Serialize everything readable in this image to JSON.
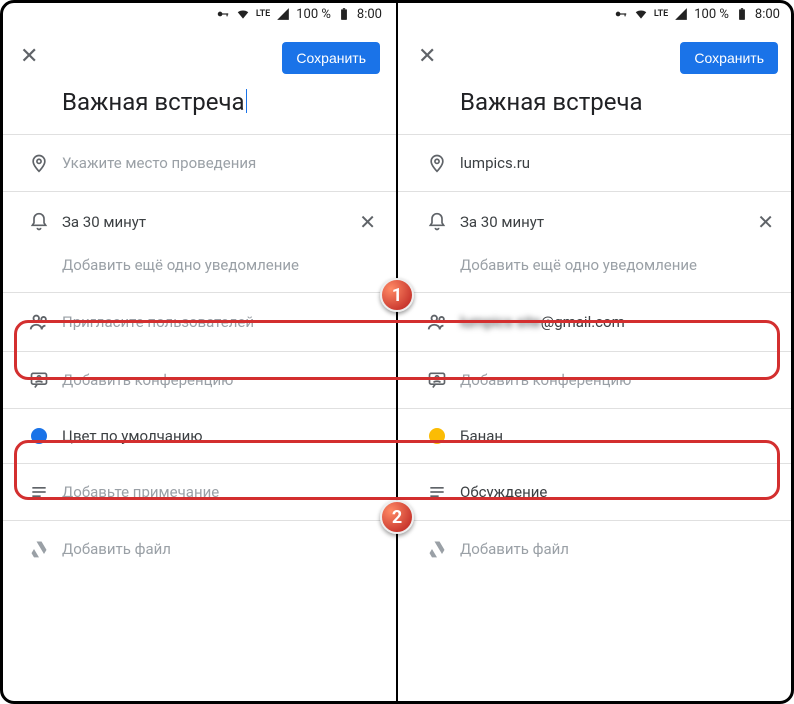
{
  "status": {
    "signal_label": "LTE",
    "battery_pct": "100 %",
    "time": "8:00"
  },
  "header": {
    "save_label": "Сохранить"
  },
  "left": {
    "title": "Важная встреча",
    "location_placeholder": "Укажите место проведения",
    "reminder_text": "За 30 минут",
    "add_reminder_label": "Добавить ещё одно уведомление",
    "invite_placeholder": "Пригласите пользователей",
    "add_conference_label": "Добавить конференцию",
    "color_label": "Цвет по умолчанию",
    "color_hex": "#1a73e8",
    "note_placeholder": "Добавьте примечание",
    "attach_label": "Добавить файл"
  },
  "right": {
    "title": "Важная встреча",
    "location_value": "lumpics.ru",
    "reminder_text": "За 30 минут",
    "add_reminder_label": "Добавить ещё одно уведомление",
    "invitee_blurred": "lumpics site",
    "invitee_domain": "@gmail.com",
    "add_conference_label": "Добавить конференцию",
    "color_label": "Банан",
    "color_hex": "#fbbc04",
    "note_value": "Обсуждение",
    "attach_label": "Добавить файл"
  },
  "callouts": {
    "one": "1",
    "two": "2"
  }
}
